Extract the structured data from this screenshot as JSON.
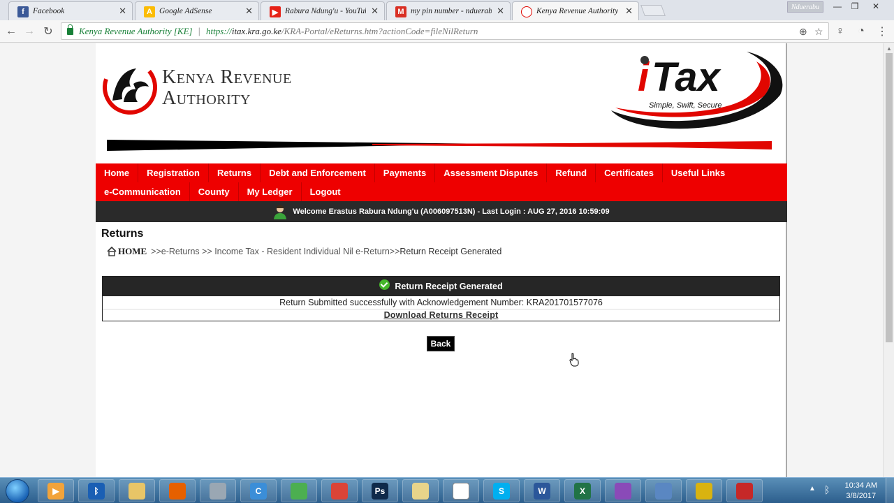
{
  "browser": {
    "tabs": [
      {
        "label": "Facebook",
        "icon": "facebook-icon",
        "color": "#3b5998",
        "glyph": "f"
      },
      {
        "label": "Google AdSense",
        "icon": "adsense-icon",
        "color": "#fbbc05",
        "glyph": "A"
      },
      {
        "label": "Rabura Ndung'u - YouTube",
        "icon": "youtube-icon",
        "color": "#e62117",
        "glyph": "▶"
      },
      {
        "label": "my pin number - nduerabu",
        "icon": "gmail-icon",
        "color": "#d93025",
        "glyph": "M"
      },
      {
        "label": "Kenya Revenue Authority",
        "icon": "kra-favicon-icon",
        "color": "#ffffff",
        "glyph": ""
      }
    ],
    "profile_name": "Nduerabu",
    "address": {
      "ev_label": "Kenya Revenue Authority [KE]",
      "url_scheme": "https://",
      "url_host": "itax.kra.go.ke",
      "url_path": "/KRA-Portal/eReturns.htm?actionCode=fileNilReturn"
    }
  },
  "header": {
    "org_line1": "Kenya Revenue",
    "org_line2": "Authority",
    "itax_tagline": "Simple, Swift, Secure"
  },
  "menu": {
    "row1": [
      "Home",
      "Registration",
      "Returns",
      "Debt and Enforcement",
      "Payments",
      "Assessment Disputes",
      "Refund",
      "Certificates",
      "Useful Links"
    ],
    "row2": [
      "e-Communication",
      "County",
      "My Ledger",
      "Logout"
    ]
  },
  "welcome_text": "Welcome Erastus Rabura Ndung'u (A006097513N)  - Last Login : AUG 27, 2016 10:59:09",
  "page": {
    "title": "Returns",
    "breadcrumb_home": "HOME",
    "breadcrumb_trail": ">>e-Returns >> Income Tax - Resident Individual Nil e-Return>>",
    "breadcrumb_current": " Return Receipt Generated"
  },
  "receipt": {
    "heading": "Return Receipt Generated",
    "message": "Return Submitted successfully with Acknowledgement Number: KRA201701577076",
    "download_link": "Download Returns Receipt"
  },
  "back_label": "Back",
  "taskbar": {
    "time": "10:34 AM",
    "date": "3/8/2017",
    "apps": [
      {
        "icon": "media-player-icon",
        "color": "#f2a33a",
        "glyph": "▶"
      },
      {
        "icon": "bluetooth-icon",
        "color": "#1a5fb4",
        "glyph": "ᛒ"
      },
      {
        "icon": "file-explorer-icon",
        "color": "#e8c567",
        "glyph": ""
      },
      {
        "icon": "firefox-icon",
        "color": "#e66000",
        "glyph": ""
      },
      {
        "icon": "calculator-icon",
        "color": "#9aa7b3",
        "glyph": ""
      },
      {
        "icon": "ccleaner-icon",
        "color": "#3b8ed8",
        "glyph": "C"
      },
      {
        "icon": "app-green-icon",
        "color": "#4caf50",
        "glyph": ""
      },
      {
        "icon": "chrome-icon",
        "color": "#db4437",
        "glyph": ""
      },
      {
        "icon": "photoshop-icon",
        "color": "#0f2a4a",
        "glyph": "Ps"
      },
      {
        "icon": "folder-icon",
        "color": "#e8d48a",
        "glyph": ""
      },
      {
        "icon": "itax-form-icon",
        "color": "#ffffff",
        "glyph": ""
      },
      {
        "icon": "skype-icon",
        "color": "#00aff0",
        "glyph": "S"
      },
      {
        "icon": "word-icon",
        "color": "#2b579a",
        "glyph": "W"
      },
      {
        "icon": "excel-icon",
        "color": "#217346",
        "glyph": "X"
      },
      {
        "icon": "winrar-icon",
        "color": "#8a4ab8",
        "glyph": ""
      },
      {
        "icon": "screen-tool-icon",
        "color": "#5a87c2",
        "glyph": ""
      },
      {
        "icon": "app-yellow-icon",
        "color": "#d9b310",
        "glyph": ""
      },
      {
        "icon": "recorder-icon",
        "color": "#c62828",
        "glyph": ""
      }
    ]
  }
}
